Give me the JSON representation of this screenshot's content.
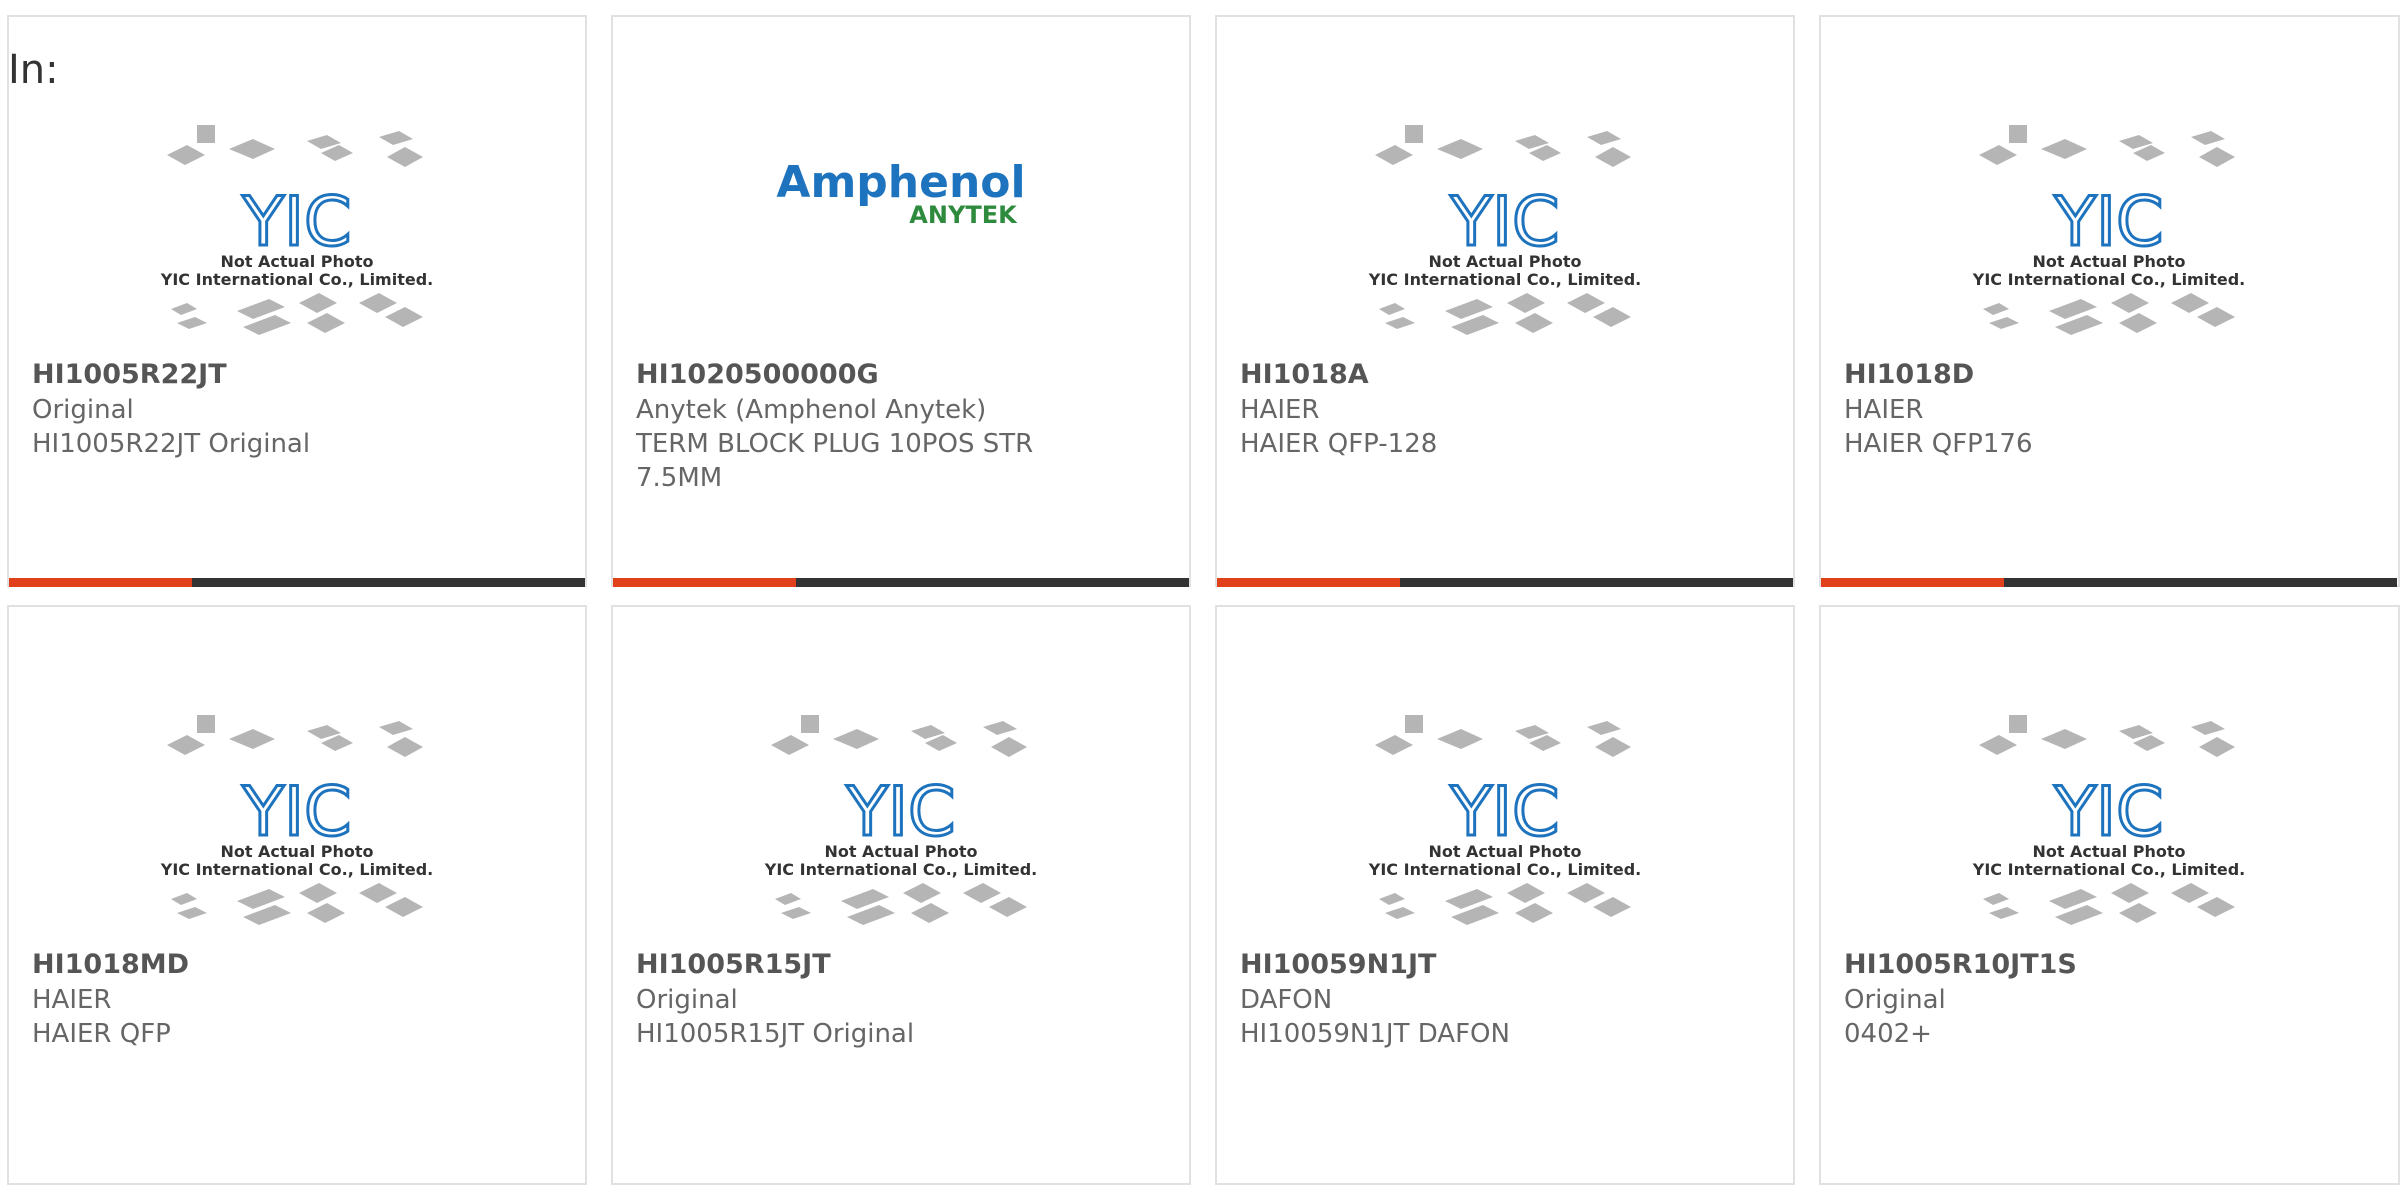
{
  "filter_label": "In:",
  "colors": {
    "accent": "#e0401c",
    "bar_dark": "#333333",
    "border": "#e1e1e1",
    "brand_blue": "#1e73be",
    "brand_green": "#2e8b3e"
  },
  "placeholder": {
    "line1": "Not Actual Photo",
    "line2": "YIC International Co., Limited.",
    "logo_text": "YIC"
  },
  "amphenol_logo": {
    "word": "Amphenol",
    "sub": "ANYTEK"
  },
  "products": [
    {
      "part": "HI1005R22JT",
      "manufacturer": "Original",
      "description": "HI1005R22JT Original",
      "image": "placeholder"
    },
    {
      "part": "HI1020500000G",
      "manufacturer": "Anytek (Amphenol Anytek)",
      "description": "TERM BLOCK PLUG 10POS STR",
      "description2": "7.5MM",
      "image": "amphenol-logo"
    },
    {
      "part": "HI1018A",
      "manufacturer": "HAIER",
      "description": "HAIER QFP-128",
      "image": "placeholder"
    },
    {
      "part": "HI1018D",
      "manufacturer": "HAIER",
      "description": "HAIER QFP176",
      "image": "placeholder"
    },
    {
      "part": "HI1018MD",
      "manufacturer": "HAIER",
      "description": "HAIER QFP",
      "image": "placeholder"
    },
    {
      "part": "HI1005R15JT",
      "manufacturer": "Original",
      "description": "HI1005R15JT Original",
      "image": "placeholder"
    },
    {
      "part": "HI10059N1JT",
      "manufacturer": "DAFON",
      "description": "HI10059N1JT DAFON",
      "image": "placeholder"
    },
    {
      "part": "HI1005R10JT1S",
      "manufacturer": "Original",
      "description": "0402+",
      "image": "placeholder"
    }
  ]
}
